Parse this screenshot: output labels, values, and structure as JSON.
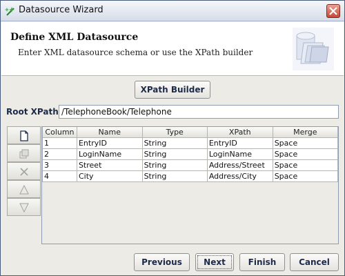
{
  "window": {
    "title": "Datasource Wizard",
    "close_icon": "close-icon"
  },
  "header": {
    "title": "Define XML Datasource",
    "subtitle": "Enter XML datasource schema or use the XPath builder",
    "graphic_icon": "database-icon"
  },
  "xpath_builder_label": "XPath Builder",
  "root_xpath": {
    "label": "Root XPath:",
    "value": "/TelephoneBook/Telephone"
  },
  "toolbar": [
    {
      "icon": "new-row-icon",
      "enabled": true
    },
    {
      "icon": "copy-row-icon",
      "enabled": false
    },
    {
      "icon": "delete-icon",
      "enabled": false
    },
    {
      "icon": "move-up-icon",
      "enabled": false
    },
    {
      "icon": "move-down-icon",
      "enabled": false
    }
  ],
  "table": {
    "columns": [
      "Column",
      "Name",
      "Type",
      "XPath",
      "Merge"
    ],
    "rows": [
      [
        "1",
        "EntryID",
        "String",
        "EntryID",
        "Space"
      ],
      [
        "2",
        "LoginName",
        "String",
        "LoginName",
        "Space"
      ],
      [
        "3",
        "Street",
        "String",
        "Address/Street",
        "Space"
      ],
      [
        "4",
        "City",
        "String",
        "Address/City",
        "Space"
      ]
    ]
  },
  "buttons": {
    "previous": "Previous",
    "next": "Next",
    "finish": "Finish",
    "cancel": "Cancel"
  },
  "colors": {
    "title_text": "#111111",
    "button_text": "#1c2a4a",
    "close_button": "#c4493a"
  }
}
